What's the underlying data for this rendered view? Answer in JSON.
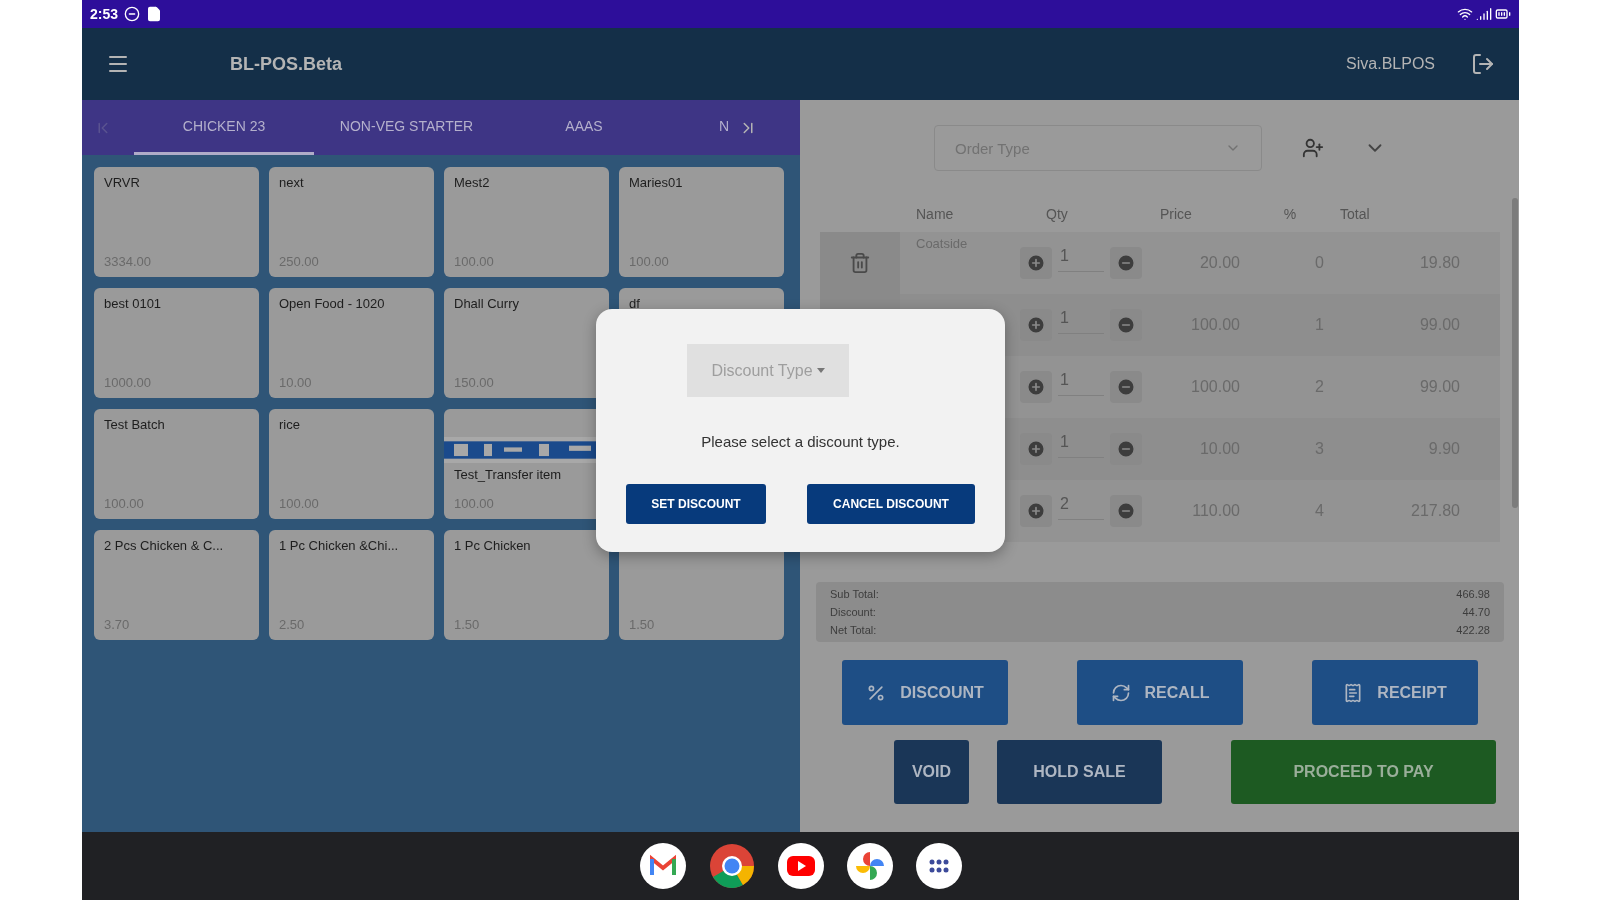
{
  "status_bar": {
    "time": "2:53"
  },
  "app_bar": {
    "title": "BL-POS.Beta",
    "user": "Siva.BLPOS"
  },
  "category_tabs": [
    {
      "label": "CHICKEN 23",
      "selected": true
    },
    {
      "label": "NON-VEG STARTER",
      "selected": false
    },
    {
      "label": "AAAS",
      "selected": false
    },
    {
      "label": "N",
      "selected": false
    }
  ],
  "product_rows": [
    [
      {
        "name": "VRVR",
        "price": "3334.00"
      },
      {
        "name": "next",
        "price": "250.00"
      },
      {
        "name": "Mest2",
        "price": "100.00"
      },
      {
        "name": "Maries01",
        "price": "100.00"
      }
    ],
    [
      {
        "name": "best 0101",
        "price": "1000.00"
      },
      {
        "name": "Open Food - 1020",
        "price": "10.00"
      },
      {
        "name": "Dhall Curry",
        "price": "150.00"
      },
      {
        "name": "df"
      }
    ],
    [
      {
        "name": "Test Batch",
        "price": "100.00"
      },
      {
        "name": "rice",
        "price": "100.00"
      },
      {
        "name": "Test_Transfer item",
        "price": "100.00",
        "kind": "picture"
      }
    ],
    [
      {
        "name": "2 Pcs Chicken & C...",
        "price": "3.70"
      },
      {
        "name": "1 Pc Chicken &Chi...",
        "price": "2.50"
      },
      {
        "name": "1 Pc Chicken",
        "price": "1.50"
      },
      {
        "price": "1.50"
      }
    ]
  ],
  "order": {
    "order_type_placeholder": "Order Type",
    "columns": [
      "Name",
      "Qty",
      "Price",
      "%",
      "Total"
    ],
    "rows": [
      {
        "name": "Coatside",
        "qty": "1",
        "price": "20.00",
        "percent": "0",
        "total": "19.80",
        "delete_icon": true
      },
      {
        "qty": "1",
        "price": "100.00",
        "percent": "1",
        "total": "99.00"
      },
      {
        "qty": "1",
        "price": "100.00",
        "percent": "2",
        "total": "99.00"
      },
      {
        "qty": "1",
        "price": "10.00",
        "percent": "3",
        "total": "9.90"
      },
      {
        "qty": "2",
        "price": "110.00",
        "percent": "4",
        "total": "217.80"
      }
    ]
  },
  "summary": [
    {
      "label": "Sub Total:",
      "value": "466.98"
    },
    {
      "label": "Discount:",
      "value": "44.70"
    },
    {
      "label": "Net Total:",
      "value": "422.28"
    }
  ],
  "actions": [
    {
      "label": "DISCOUNT",
      "kind": "discount"
    },
    {
      "label": "RECALL",
      "kind": "recall"
    },
    {
      "label": "RECEIPT",
      "kind": "receipt"
    }
  ],
  "footer_actions": [
    {
      "label": "VOID",
      "kind": "dark"
    },
    {
      "label": "HOLD SALE",
      "kind": "dark"
    },
    {
      "label": "PROCEED TO PAY",
      "kind": "pay"
    }
  ],
  "dialog": {
    "dropdown_placeholder": "Discount Type",
    "message": "Please select a discount type.",
    "buttons": [
      "SET DISCOUNT",
      "CANCEL DISCOUNT"
    ]
  }
}
